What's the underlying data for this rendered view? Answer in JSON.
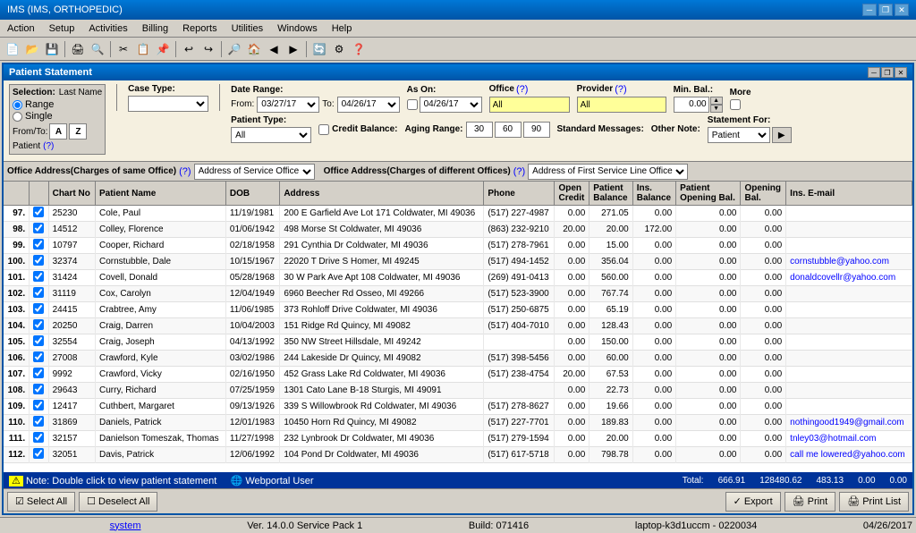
{
  "app": {
    "title": "IMS (IMS, ORTHOPEDIC)"
  },
  "menu": {
    "items": [
      "Action",
      "Setup",
      "Activities",
      "Billing",
      "Reports",
      "Utilities",
      "Windows",
      "Help"
    ]
  },
  "window": {
    "title": "Patient Statement"
  },
  "filters": {
    "selection_label": "Selection:",
    "last_name_label": "Last Name",
    "from_to_label": "From/To:",
    "range_label": "Range",
    "single_label": "Single",
    "from_value": "A",
    "to_value": "Z",
    "patient_label": "Patient",
    "patient_q": "(?)",
    "case_type_label": "Case Type:",
    "case_type_value": "",
    "patient_type_label": "Patient Type:",
    "patient_type_value": "All",
    "date_range_label": "Date Range:",
    "from_date": "03/27/17",
    "to_date_label": "To:",
    "to_date": "04/26/17",
    "as_on_label": "As On:",
    "as_on_date": "04/26/17",
    "office_label": "Office",
    "office_q": "(?)",
    "office_value": "All",
    "provider_label": "Provider",
    "provider_q": "(?)",
    "provider_value": "All",
    "min_bal_label": "Min. Bal.:",
    "min_bal_value": "0.00",
    "more_label": "More",
    "credit_balance_label": "Credit Balance:",
    "standard_messages_label": "Standard Messages:",
    "aging_range_label": "Aging Range:",
    "aging_30": "30",
    "aging_60": "60",
    "aging_90": "90",
    "other_note_label": "Other Note:",
    "statement_for_label": "Statement For:",
    "statement_for_value": "Patient"
  },
  "office_tabs": {
    "same_label": "Office Address(Charges of same Office)",
    "same_q": "(?)",
    "same_value": "Address of Service Office",
    "diff_label": "Office Address(Charges of different Offices)",
    "diff_q": "(?)",
    "diff_value": "Address of First Service Line Office"
  },
  "table": {
    "columns": [
      "",
      "Chart No",
      "Patient Name",
      "DOB",
      "Address",
      "Phone",
      "Open Credit",
      "Patient Balance",
      "Ins. Balance",
      "Patient Opening Bal.",
      "Opening Bal.",
      "Ins. E-mail"
    ],
    "rows": [
      {
        "num": "97.",
        "check": true,
        "chart": "25230",
        "name": "Cole, Paul",
        "dob": "11/19/1981",
        "address": "200 E Garfield Ave Lot 171 Coldwater, MI 49036",
        "phone": "(517) 227-4987",
        "open_credit": "0.00",
        "patient_balance": "271.05",
        "ins_balance": "0.00",
        "patient_opening": "0.00",
        "opening": "0.00",
        "email": ""
      },
      {
        "num": "98.",
        "check": true,
        "chart": "14512",
        "name": "Colley, Florence",
        "dob": "01/06/1942",
        "address": "498 Morse St Coldwater, MI 49036",
        "phone": "(863) 232-9210",
        "open_credit": "20.00",
        "patient_balance": "20.00",
        "ins_balance": "172.00",
        "patient_opening": "0.00",
        "opening": "0.00",
        "email": ""
      },
      {
        "num": "99.",
        "check": true,
        "chart": "10797",
        "name": "Cooper, Richard",
        "dob": "02/18/1958",
        "address": "291 Cynthia Dr Coldwater, MI 49036",
        "phone": "(517) 278-7961",
        "open_credit": "0.00",
        "patient_balance": "15.00",
        "ins_balance": "0.00",
        "patient_opening": "0.00",
        "opening": "0.00",
        "email": ""
      },
      {
        "num": "100.",
        "check": true,
        "chart": "32374",
        "name": "Cornstubble, Dale",
        "dob": "10/15/1967",
        "address": "22020 T Drive S Homer, MI 49245",
        "phone": "(517) 494-1452",
        "open_credit": "0.00",
        "patient_balance": "356.04",
        "ins_balance": "0.00",
        "patient_opening": "0.00",
        "opening": "0.00",
        "email": "cornstubble@yahoo.com"
      },
      {
        "num": "101.",
        "check": true,
        "chart": "31424",
        "name": "Covell, Donald",
        "dob": "05/28/1968",
        "address": "30 W Park Ave Apt 108 Coldwater, MI 49036",
        "phone": "(269) 491-0413",
        "open_credit": "0.00",
        "patient_balance": "560.00",
        "ins_balance": "0.00",
        "patient_opening": "0.00",
        "opening": "0.00",
        "email": "donaldcovellr@yahoo.com"
      },
      {
        "num": "102.",
        "check": true,
        "chart": "31119",
        "name": "Cox, Carolyn",
        "dob": "12/04/1949",
        "address": "6960 Beecher Rd Osseo, MI 49266",
        "phone": "(517) 523-3900",
        "open_credit": "0.00",
        "patient_balance": "767.74",
        "ins_balance": "0.00",
        "patient_opening": "0.00",
        "opening": "0.00",
        "email": ""
      },
      {
        "num": "103.",
        "check": true,
        "chart": "24415",
        "name": "Crabtree, Amy",
        "dob": "11/06/1985",
        "address": "373 Rohloff Drive Coldwater, MI 49036",
        "phone": "(517) 250-6875",
        "open_credit": "0.00",
        "patient_balance": "65.19",
        "ins_balance": "0.00",
        "patient_opening": "0.00",
        "opening": "0.00",
        "email": ""
      },
      {
        "num": "104.",
        "check": true,
        "chart": "20250",
        "name": "Craig, Darren",
        "dob": "10/04/2003",
        "address": "151 Ridge Rd Quincy, MI 49082",
        "phone": "(517) 404-7010",
        "open_credit": "0.00",
        "patient_balance": "128.43",
        "ins_balance": "0.00",
        "patient_opening": "0.00",
        "opening": "0.00",
        "email": ""
      },
      {
        "num": "105.",
        "check": true,
        "chart": "32554",
        "name": "Craig, Joseph",
        "dob": "04/13/1992",
        "address": "350 NW Street Hillsdale, MI 49242",
        "phone": "",
        "open_credit": "0.00",
        "patient_balance": "150.00",
        "ins_balance": "0.00",
        "patient_opening": "0.00",
        "opening": "0.00",
        "email": ""
      },
      {
        "num": "106.",
        "check": true,
        "chart": "27008",
        "name": "Crawford, Kyle",
        "dob": "03/02/1986",
        "address": "244 Lakeside Dr Quincy, MI 49082",
        "phone": "(517) 398-5456",
        "open_credit": "0.00",
        "patient_balance": "60.00",
        "ins_balance": "0.00",
        "patient_opening": "0.00",
        "opening": "0.00",
        "email": ""
      },
      {
        "num": "107.",
        "check": true,
        "chart": "9992",
        "name": "Crawford, Vicky",
        "dob": "02/16/1950",
        "address": "452 Grass Lake Rd Coldwater, MI 49036",
        "phone": "(517) 238-4754",
        "open_credit": "20.00",
        "patient_balance": "67.53",
        "ins_balance": "0.00",
        "patient_opening": "0.00",
        "opening": "0.00",
        "email": ""
      },
      {
        "num": "108.",
        "check": true,
        "chart": "29643",
        "name": "Curry, Richard",
        "dob": "07/25/1959",
        "address": "1301 Cato Lane B-18 Sturgis, MI 49091",
        "phone": "",
        "open_credit": "0.00",
        "patient_balance": "22.73",
        "ins_balance": "0.00",
        "patient_opening": "0.00",
        "opening": "0.00",
        "email": ""
      },
      {
        "num": "109.",
        "check": true,
        "chart": "12417",
        "name": "Cuthbert, Margaret",
        "dob": "09/13/1926",
        "address": "339 S Willowbrook Rd Coldwater, MI 49036",
        "phone": "(517) 278-8627",
        "open_credit": "0.00",
        "patient_balance": "19.66",
        "ins_balance": "0.00",
        "patient_opening": "0.00",
        "opening": "0.00",
        "email": ""
      },
      {
        "num": "110.",
        "check": true,
        "chart": "31869",
        "name": "Daniels, Patrick",
        "dob": "12/01/1983",
        "address": "10450 Horn Rd Quincy, MI 49082",
        "phone": "(517) 227-7701",
        "open_credit": "0.00",
        "patient_balance": "189.83",
        "ins_balance": "0.00",
        "patient_opening": "0.00",
        "opening": "0.00",
        "email": "nothingood1949@gmail.com"
      },
      {
        "num": "111.",
        "check": true,
        "chart": "32157",
        "name": "Danielson Tomeszak, Thomas",
        "dob": "11/27/1998",
        "address": "232 Lynbrook Dr Coldwater, MI 49036",
        "phone": "(517) 279-1594",
        "open_credit": "0.00",
        "patient_balance": "20.00",
        "ins_balance": "0.00",
        "patient_opening": "0.00",
        "opening": "0.00",
        "email": "tnley03@hotmail.com"
      },
      {
        "num": "112.",
        "check": true,
        "chart": "32051",
        "name": "Davis, Patrick",
        "dob": "12/06/1992",
        "address": "104 Pond Dr Coldwater, MI 49036",
        "phone": "(517) 617-5718",
        "open_credit": "0.00",
        "patient_balance": "798.78",
        "ins_balance": "0.00",
        "patient_opening": "0.00",
        "opening": "0.00",
        "email": "call me lowered@yahoo.com"
      }
    ]
  },
  "status": {
    "note": "Note: Double click to view patient statement",
    "webportal": "Webportal User",
    "total_label": "Total:",
    "total_open_credit": "666.91",
    "total_patient_balance": "128480.62",
    "total_ins_balance": "483.13",
    "total_patient_opening": "0.00",
    "total_opening": "0.00"
  },
  "bottom_buttons": {
    "select_all": "Select All",
    "deselect_all": "Deselect All",
    "export": "Export",
    "print": "Print",
    "print_list": "Print List"
  },
  "app_bottom": {
    "system": "system",
    "version": "Ver. 14.0.0 Service Pack 1",
    "build": "Build: 071416",
    "laptop": "laptop-k3d1uccm - 0220034",
    "date": "04/26/2017"
  }
}
